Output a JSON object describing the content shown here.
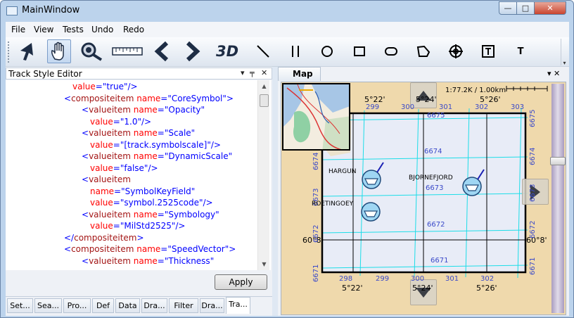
{
  "window": {
    "title": "MainWindow",
    "min": "—",
    "max": "□",
    "close": "✕"
  },
  "menu": [
    "File",
    "View",
    "Tests",
    "Undo",
    "Redo"
  ],
  "toolbar": {
    "tools": [
      "select-arrow",
      "pan-hand",
      "zoom-magnifier",
      "measure-scale",
      "back",
      "forward",
      "3d-view",
      "draw-line",
      "draw-parallel",
      "draw-circle",
      "draw-rectangle",
      "draw-rounded-rect",
      "draw-polygon",
      "draw-target-symbol",
      "text-box",
      "text"
    ],
    "label_3d": "3D",
    "text_tool": "T"
  },
  "track_style_editor": {
    "title": "Track Style Editor",
    "pin": "▾ 🖈",
    "close": "✕",
    "xml_lines": [
      {
        "indent": 95,
        "parts": [
          [
            "at",
            "value"
          ],
          [
            "bl",
            "="
          ],
          [
            "av",
            "\"true\""
          ],
          [
            "bl",
            "/>"
          ]
        ]
      },
      {
        "indent": 83,
        "parts": [
          [
            "bl",
            "<"
          ],
          [
            "t",
            "compositeitem "
          ],
          [
            "at",
            "name"
          ],
          [
            "bl",
            "="
          ],
          [
            "av",
            "\"CoreSymbol\""
          ],
          [
            "bl",
            ">"
          ]
        ]
      },
      {
        "indent": 108,
        "parts": [
          [
            "bl",
            "<"
          ],
          [
            "t",
            "valueitem "
          ],
          [
            "at",
            "name"
          ],
          [
            "bl",
            "="
          ],
          [
            "av",
            "\"Opacity\""
          ]
        ]
      },
      {
        "indent": 120,
        "parts": [
          [
            "at",
            "value"
          ],
          [
            "bl",
            "="
          ],
          [
            "av",
            "\"1.0\""
          ],
          [
            "bl",
            "/>"
          ]
        ]
      },
      {
        "indent": 108,
        "parts": [
          [
            "bl",
            "<"
          ],
          [
            "t",
            "valueitem "
          ],
          [
            "at",
            "name"
          ],
          [
            "bl",
            "="
          ],
          [
            "av",
            "\"Scale\""
          ]
        ]
      },
      {
        "indent": 120,
        "parts": [
          [
            "at",
            "value"
          ],
          [
            "bl",
            "="
          ],
          [
            "av",
            "\"[track.symbolscale]\""
          ],
          [
            "bl",
            "/>"
          ]
        ]
      },
      {
        "indent": 108,
        "parts": [
          [
            "bl",
            "<"
          ],
          [
            "t",
            "valueitem "
          ],
          [
            "at",
            "name"
          ],
          [
            "bl",
            "="
          ],
          [
            "av",
            "\"DynamicScale\""
          ]
        ]
      },
      {
        "indent": 120,
        "parts": [
          [
            "at",
            "value"
          ],
          [
            "bl",
            "="
          ],
          [
            "av",
            "\"false\""
          ],
          [
            "bl",
            "/>"
          ]
        ]
      },
      {
        "indent": 108,
        "parts": [
          [
            "bl",
            "<"
          ],
          [
            "t",
            "valueitem"
          ]
        ]
      },
      {
        "indent": 120,
        "parts": [
          [
            "at",
            "name"
          ],
          [
            "bl",
            "="
          ],
          [
            "av",
            "\"SymbolKeyField\""
          ]
        ]
      },
      {
        "indent": 120,
        "parts": [
          [
            "at",
            "value"
          ],
          [
            "bl",
            "="
          ],
          [
            "av",
            "\"symbol.2525code\""
          ],
          [
            "bl",
            "/>"
          ]
        ]
      },
      {
        "indent": 108,
        "parts": [
          [
            "bl",
            "<"
          ],
          [
            "t",
            "valueitem "
          ],
          [
            "at",
            "name"
          ],
          [
            "bl",
            "="
          ],
          [
            "av",
            "\"Symbology\""
          ]
        ]
      },
      {
        "indent": 120,
        "parts": [
          [
            "at",
            "value"
          ],
          [
            "bl",
            "="
          ],
          [
            "av",
            "\"MilStd2525\""
          ],
          [
            "bl",
            "/>"
          ]
        ]
      },
      {
        "indent": 83,
        "parts": [
          [
            "bl",
            "</"
          ],
          [
            "t",
            "compositeitem"
          ],
          [
            "bl",
            ">"
          ]
        ]
      },
      {
        "indent": 83,
        "parts": [
          [
            "bl",
            "<"
          ],
          [
            "t",
            "compositeitem "
          ],
          [
            "at",
            "name"
          ],
          [
            "bl",
            "="
          ],
          [
            "av",
            "\"SpeedVector\""
          ],
          [
            "bl",
            ">"
          ]
        ]
      },
      {
        "indent": 108,
        "parts": [
          [
            "bl",
            "<"
          ],
          [
            "t",
            "valueitem "
          ],
          [
            "at",
            "name"
          ],
          [
            "bl",
            "="
          ],
          [
            "av",
            "\"Thickness\""
          ]
        ]
      }
    ],
    "apply_label": "Apply",
    "tabs": [
      "Set...",
      "Sea...",
      "Pro...",
      "Def",
      "Data",
      "Dra...",
      "Filter",
      "Dra...",
      "Tra..."
    ],
    "selected_tab": "Tra..."
  },
  "map": {
    "tab_label": "Map",
    "pane_icons": "▾ ✕",
    "scale": "1:77.2K / 1.00km",
    "coords": {
      "top_left_lon": "5°22'",
      "top_mid_lon": "5°24'",
      "top_right_lon": "5°26'",
      "bottom_left_lon": "5°22'",
      "bottom_mid_lon": "5°24'",
      "bottom_right_lon": "5°26'",
      "left_lat": "60°8'",
      "right_lat": "60°8'"
    },
    "grid_top": [
      "299",
      "300",
      "301",
      "302",
      "303"
    ],
    "grid_bottom": [
      "298",
      "299",
      "300",
      "301",
      "302"
    ],
    "grid_left": [
      "6674",
      "6673",
      "6672",
      "6671"
    ],
    "grid_right": [
      "6675",
      "6674",
      "6673",
      "6672",
      "6671"
    ],
    "grid_inner": [
      "6675",
      "6674",
      "6673",
      "6672",
      "6671"
    ],
    "places": [
      "HARGUN",
      "BJORNEFJORD",
      "ROETINGOEY"
    ],
    "colors": {
      "land": "#efd9ac",
      "sea": "#e8ecf7",
      "grid": "#1ddde8",
      "frame": "#000000",
      "symbol": "#9fd6f3"
    }
  }
}
